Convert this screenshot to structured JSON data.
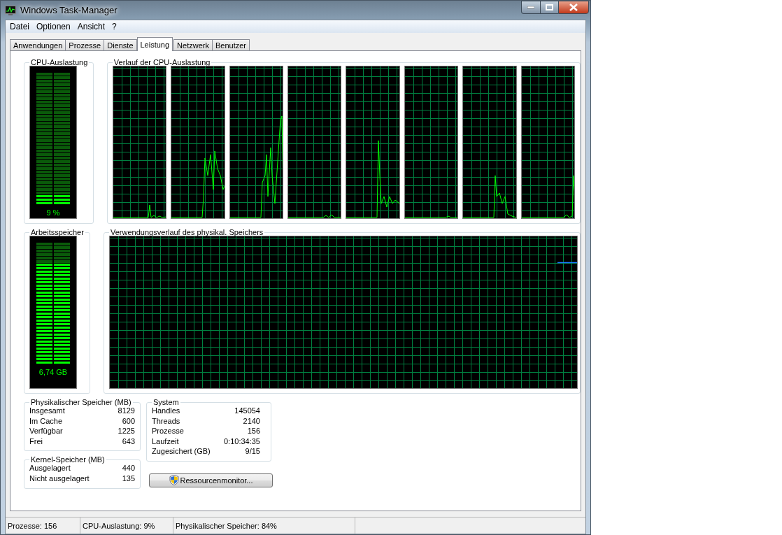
{
  "window": {
    "title": "Windows Task-Manager"
  },
  "menu": [
    "Datei",
    "Optionen",
    "Ansicht",
    "?"
  ],
  "tabs": [
    {
      "label": "Anwendungen",
      "selected": false
    },
    {
      "label": "Prozesse",
      "selected": false
    },
    {
      "label": "Dienste",
      "selected": false
    },
    {
      "label": "Leistung",
      "selected": true
    },
    {
      "label": "Netzwerk",
      "selected": false
    },
    {
      "label": "Benutzer",
      "selected": false
    }
  ],
  "cpu_meter": {
    "title": "CPU-Auslastung",
    "level": 0.09,
    "reading": "9 %"
  },
  "cpu_history": {
    "title": "Verlauf der CPU-Auslastung"
  },
  "memory_meter": {
    "title": "Arbeitsspeicher",
    "level": 0.84,
    "reading": "6,74 GB"
  },
  "memory_history": {
    "title": "Verwendungsverlauf des physikal. Speichers"
  },
  "physical_memory": {
    "title": "Physikalischer Speicher (MB)",
    "rows": [
      {
        "label": "Insgesamt",
        "value": "8129"
      },
      {
        "label": "Im Cache",
        "value": "600"
      },
      {
        "label": "Verfügbar",
        "value": "1225"
      },
      {
        "label": "Frei",
        "value": "643"
      }
    ]
  },
  "kernel_memory": {
    "title": "Kernel-Speicher (MB)",
    "rows": [
      {
        "label": "Ausgelagert",
        "value": "440"
      },
      {
        "label": "Nicht ausgelagert",
        "value": "135"
      }
    ]
  },
  "system": {
    "title": "System",
    "rows": [
      {
        "label": "Handles",
        "value": "145054"
      },
      {
        "label": "Threads",
        "value": "2140"
      },
      {
        "label": "Prozesse",
        "value": "156"
      },
      {
        "label": "Laufzeit",
        "value": "0:10:34:35"
      },
      {
        "label": "Zugesichert (GB)",
        "value": "9/15"
      }
    ]
  },
  "resource_button": {
    "label": "Ressourcenmonitor..."
  },
  "status_bar": [
    "Prozesse: 156",
    "CPU-Auslastung: 9%",
    "Physikalischer Speicher: 84%"
  ]
}
